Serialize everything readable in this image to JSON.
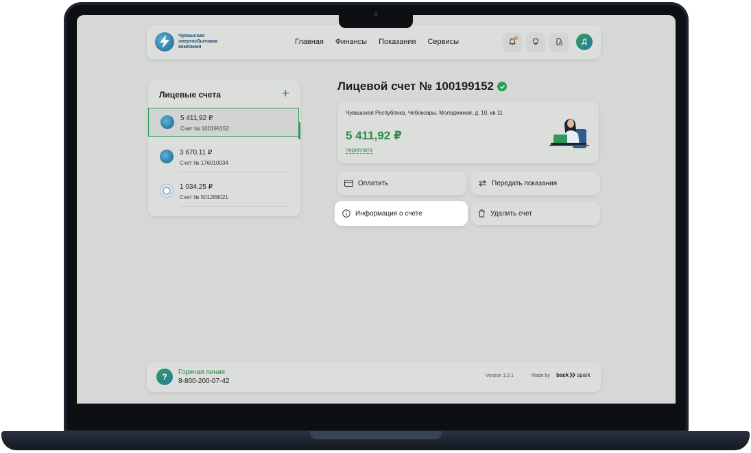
{
  "brand": {
    "name": "Чувашская энергосбытовая компания"
  },
  "nav": [
    {
      "label": "Главная"
    },
    {
      "label": "Финансы"
    },
    {
      "label": "Показания"
    },
    {
      "label": "Сервисы"
    }
  ],
  "header_icons": [
    "bell-icon",
    "lightbulb-icon",
    "document-clock-icon"
  ],
  "user": {
    "initial": "Д"
  },
  "accounts": {
    "title": "Лицевые счета",
    "items": [
      {
        "amount": "5 411,92 ₽",
        "number": "Счет № 100199152",
        "logo": "chuvash-energo-logo",
        "active": true
      },
      {
        "amount": "3 670,11 ₽",
        "number": "Счет № 176010034",
        "logo": "chuvash-energo-logo",
        "active": false
      },
      {
        "amount": "1 034,25 ₽",
        "number": "Счет № 501288021",
        "logo": "water-utility-logo",
        "active": false
      }
    ]
  },
  "account": {
    "title": "Лицевой счет № 100199152",
    "address": "Чувашская Республика, Чебоксары, Молодежная, д. 10, кв 11",
    "balance": "5 411,92 ₽",
    "balance_note": "переплата"
  },
  "actions": {
    "pay": "Оплатить",
    "submit_readings": "Передать показания",
    "info": "Информация о счете",
    "delete": "Удалить счет"
  },
  "footer": {
    "hotline_label": "Горячая линия",
    "hotline_phone": "8-800-200-07-42",
    "version": "Version 1.0.1",
    "made_by": "Made by",
    "maker_a": "back",
    "maker_b": "spark"
  },
  "colors": {
    "accent": "#2a8a4b",
    "screen_bg": "#d6d8d5",
    "brand_blue": "#1f4d73"
  }
}
